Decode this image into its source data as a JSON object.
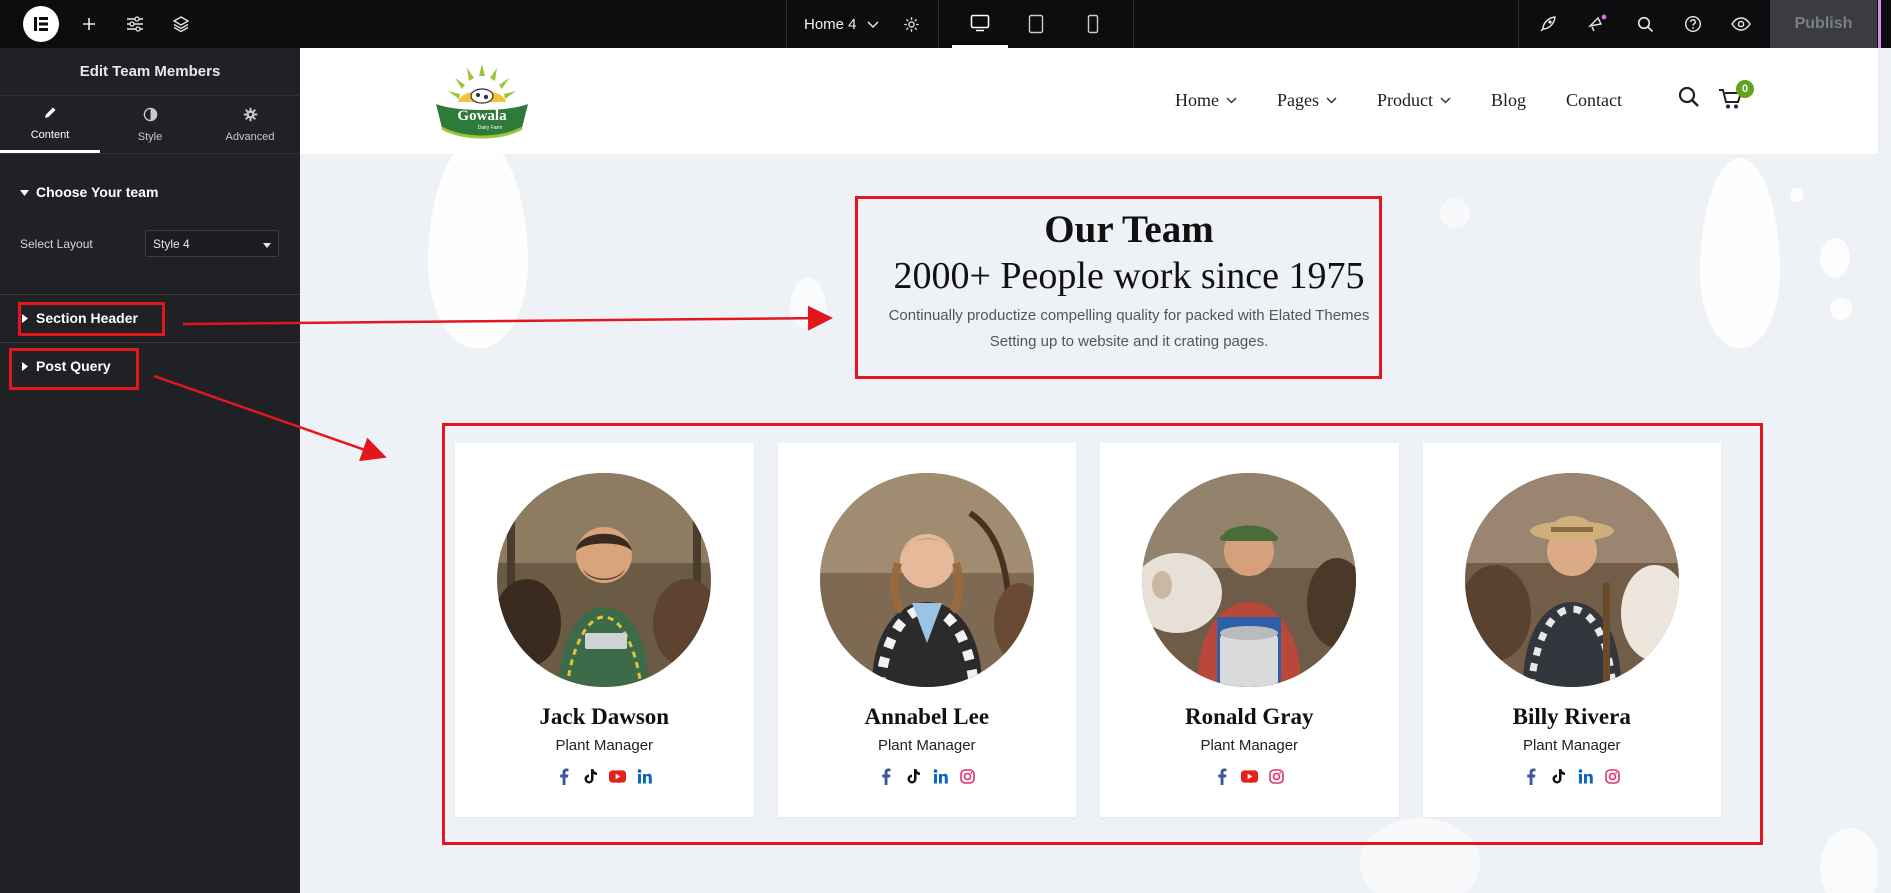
{
  "topbar": {
    "logo_icon": "elementor-logo-icon",
    "left_icons": [
      "plus-icon",
      "sliders-icon",
      "layers-icon"
    ],
    "page_name": "Home 4",
    "device_icons": [
      "desktop-icon",
      "tablet-icon",
      "mobile-icon"
    ],
    "right_icons": [
      "rocket-icon",
      "notifications-icon",
      "search-icon",
      "help-icon",
      "preview-eye-icon"
    ],
    "publish_label": "Publish"
  },
  "panel": {
    "title": "Edit Team Members",
    "tabs": [
      {
        "label": "Content",
        "icon": "pencil-icon",
        "active": true
      },
      {
        "label": "Style",
        "icon": "half-circle-icon",
        "active": false
      },
      {
        "label": "Advanced",
        "icon": "gear-icon",
        "active": false
      }
    ],
    "open_section": {
      "title": "Choose Your team",
      "control_label": "Select Layout",
      "control_value": "Style 4"
    },
    "collapsed_sections": [
      "Section Header",
      "Post Query"
    ]
  },
  "site": {
    "logo_text": "Gowala",
    "logo_tagline": "Dairy Farm",
    "nav": [
      {
        "label": "Home",
        "dropdown": true
      },
      {
        "label": "Pages",
        "dropdown": true
      },
      {
        "label": "Product",
        "dropdown": true
      },
      {
        "label": "Blog",
        "dropdown": false
      },
      {
        "label": "Contact",
        "dropdown": false
      }
    ],
    "cart_count": "0",
    "accent_color": "#5fa422"
  },
  "team_section": {
    "title": "Our Team",
    "subtitle": "2000+ People work since 1975",
    "description_line1": "Continually productize compelling quality for packed with Elated Themes",
    "description_line2": "Setting up to website and it crating pages."
  },
  "members": [
    {
      "name": "Jack Dawson",
      "role": "Plant Manager",
      "socials": [
        "facebook-icon",
        "tiktok-icon",
        "youtube-icon",
        "linkedin-icon"
      ]
    },
    {
      "name": "Annabel Lee",
      "role": "Plant Manager",
      "socials": [
        "facebook-icon",
        "tiktok-icon",
        "linkedin-icon",
        "instagram-icon"
      ]
    },
    {
      "name": "Ronald Gray",
      "role": "Plant Manager",
      "socials": [
        "facebook-icon",
        "youtube-icon",
        "instagram-icon"
      ]
    },
    {
      "name": "Billy Rivera",
      "role": "Plant Manager",
      "socials": [
        "facebook-icon",
        "tiktok-icon",
        "linkedin-icon",
        "instagram-icon"
      ]
    }
  ],
  "annotation_color": "#e2161d"
}
